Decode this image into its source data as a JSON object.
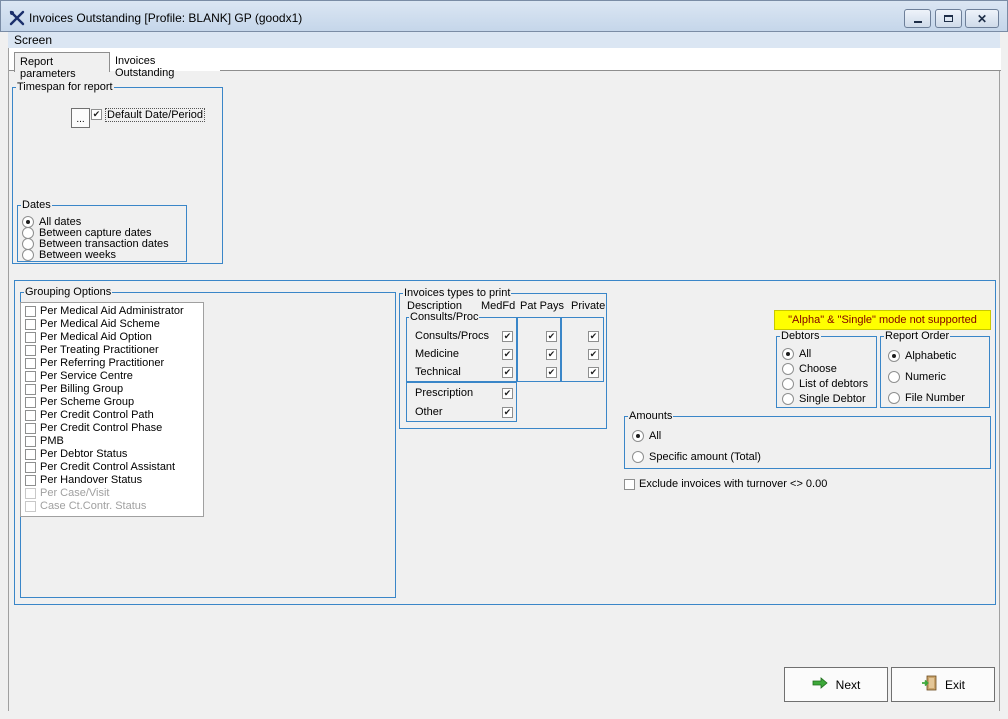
{
  "window": {
    "title": "Invoices Outstanding  [Profile: BLANK] GP (goodx1)",
    "app_icon": "tools-icon",
    "controls": [
      "minimize-icon",
      "maximize-icon",
      "close-icon"
    ]
  },
  "menu": {
    "screen": "Screen"
  },
  "tabs": [
    {
      "label": "Report parameters",
      "active": true
    },
    {
      "label": "Invoices Outstanding",
      "active": false
    }
  ],
  "timespan": {
    "title": "Timespan for report",
    "ellipsis": "...",
    "default_period_label": "Default Date/Period",
    "default_period_checked": true
  },
  "dates": {
    "title": "Dates",
    "options": [
      "All dates",
      "Between capture dates",
      "Between transaction dates",
      "Between weeks"
    ],
    "selected_index": 0
  },
  "grouping": {
    "title": "Grouping Options",
    "items": [
      {
        "label": "Per Medical Aid Administrator",
        "enabled": true
      },
      {
        "label": "Per Medical Aid Scheme",
        "enabled": true
      },
      {
        "label": "Per Medical Aid Option",
        "enabled": true
      },
      {
        "label": "Per Treating Practitioner",
        "enabled": true
      },
      {
        "label": "Per Referring Practitioner",
        "enabled": true
      },
      {
        "label": "Per Service Centre",
        "enabled": true
      },
      {
        "label": "Per Billing Group",
        "enabled": true
      },
      {
        "label": "Per Scheme Group",
        "enabled": true
      },
      {
        "label": "Per Credit Control Path",
        "enabled": true
      },
      {
        "label": "Per Credit Control Phase",
        "enabled": true
      },
      {
        "label": "PMB",
        "enabled": true
      },
      {
        "label": "Per Debtor Status",
        "enabled": true
      },
      {
        "label": "Per Credit Control Assistant",
        "enabled": true
      },
      {
        "label": "Per Handover Status",
        "enabled": true
      },
      {
        "label": "Per Case/Visit",
        "enabled": false
      },
      {
        "label": "Case Ct.Contr. Status",
        "enabled": false
      }
    ]
  },
  "invoice_types": {
    "title": "Invoices types to print",
    "col_description": "Description",
    "col_medfd": "MedFd",
    "col_patpays": "Pat Pays",
    "col_private": "Private",
    "consults_group": "Consults/Proc",
    "rows": [
      {
        "label": "Consults/Procs",
        "medfd": true,
        "patpays": true,
        "private": true
      },
      {
        "label": "Medicine",
        "medfd": true,
        "patpays": true,
        "private": true
      },
      {
        "label": "Technical",
        "medfd": true,
        "patpays": true,
        "private": true
      }
    ],
    "extra_rows": [
      {
        "label": "Prescription",
        "medfd": true
      },
      {
        "label": "Other",
        "medfd": true
      }
    ]
  },
  "banner": "\"Alpha\" & \"Single\" mode not supported",
  "debtors": {
    "title": "Debtors",
    "options": [
      "All",
      "Choose",
      "List of debtors",
      "Single Debtor"
    ],
    "selected_index": 0
  },
  "report_order": {
    "title": "Report Order",
    "options": [
      "Alphabetic",
      "Numeric",
      "File Number"
    ],
    "selected_index": 0
  },
  "amounts": {
    "title": "Amounts",
    "options": [
      "All",
      "Specific amount (Total)"
    ],
    "selected_index": 0
  },
  "exclude_turnover": {
    "label": "Exclude invoices with turnover <> 0.00",
    "checked": false
  },
  "buttons": {
    "next": {
      "label": "Next",
      "icon": "arrow-right-icon"
    },
    "exit": {
      "label": "Exit",
      "icon": "exit-door-icon"
    }
  },
  "colors": {
    "group_border": "#3a86c8",
    "banner_bg": "#ffff00",
    "banner_text": "#800000"
  }
}
